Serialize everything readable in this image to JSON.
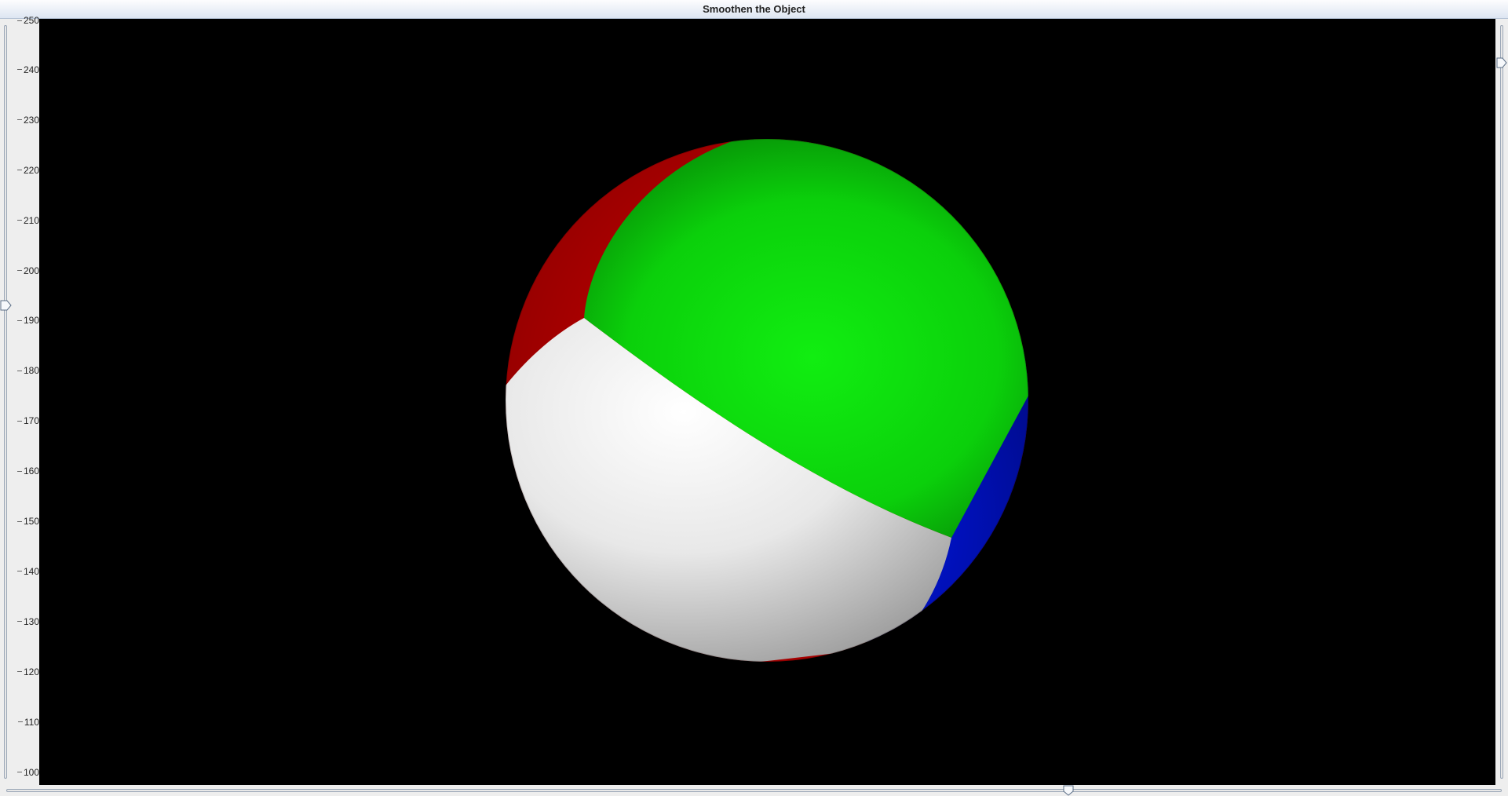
{
  "window": {
    "title": "Smoothen the Object"
  },
  "left_slider": {
    "ticks": [
      "250",
      "240",
      "230",
      "220",
      "210",
      "200",
      "190",
      "180",
      "170",
      "160",
      "150",
      "140",
      "130",
      "120",
      "110",
      "100"
    ],
    "min": 100,
    "max": 250,
    "value": 193
  },
  "right_slider": {
    "value_fraction": 0.05
  },
  "bottom_slider": {
    "value_fraction": 0.71
  },
  "scene": {
    "background": "#000000",
    "object": "sphere",
    "colors": {
      "green": "#11e011",
      "white": "#f4f4f4",
      "red": "#d00000",
      "blue": "#0010c8"
    }
  }
}
